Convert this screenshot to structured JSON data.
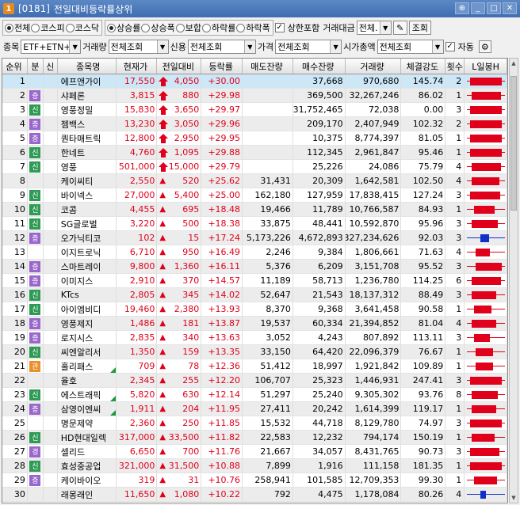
{
  "window": {
    "code": "[0181]",
    "title": "전일대비등락률상위",
    "icon": "1"
  },
  "market": {
    "options": [
      "전체",
      "코스피",
      "코스닥"
    ],
    "selected": 0
  },
  "direction": {
    "options": [
      "상승률",
      "상승폭",
      "보합",
      "하락률",
      "하락폭"
    ],
    "selected": 0
  },
  "include_limit": {
    "label": "상한포함",
    "checked": true
  },
  "amount": {
    "label": "거래대금",
    "value": "전체."
  },
  "query_label": "조회",
  "filters": {
    "kind_label": "종목",
    "kind_value": "ETF+ETN+스",
    "vol_label": "거래량",
    "vol_value": "전체조회",
    "credit_label": "신용",
    "credit_value": "전체조회",
    "price_label": "가격",
    "price_value": "전체조회",
    "cap_label": "시가총액",
    "cap_value": "전체조회",
    "auto_label": "자동",
    "auto_checked": true
  },
  "columns": [
    "순위",
    "분",
    "신",
    "종목명",
    "현재가",
    "전일대비",
    "등락률",
    "매도잔량",
    "매수잔량",
    "거래량",
    "체결강도",
    "횟수",
    "L일봉H"
  ],
  "colors": {
    "up": "#e0001b",
    "down": "#0030c8",
    "badge_green": "#2e9a55",
    "badge_purple": "#9966cc",
    "badge_orange": "#e8902a"
  },
  "rows": [
    {
      "rank": "1",
      "div": "",
      "divc": "",
      "credit": false,
      "name": "에프앤가이",
      "price": "17,550",
      "change": "4,050",
      "sign": "limit",
      "rate": "+30.00",
      "sell": "",
      "buy": "37,668",
      "vol": "970,680",
      "str": "145.74",
      "cnt": "2",
      "c": [
        0.05,
        0.95
      ],
      "cc": "r"
    },
    {
      "rank": "2",
      "div": "증",
      "divc": "purple",
      "credit": false,
      "name": "샤페론",
      "price": "3,815",
      "change": "880",
      "sign": "limit",
      "rate": "+29.98",
      "sell": "",
      "buy": "369,500",
      "vol": "32,267,246",
      "str": "86.02",
      "cnt": "1",
      "c": [
        0.1,
        0.95
      ],
      "cc": "r"
    },
    {
      "rank": "3",
      "div": "신",
      "divc": "green",
      "credit": false,
      "name": "영풍정밀",
      "price": "15,830",
      "change": "3,650",
      "sign": "limit",
      "rate": "+29.97",
      "sell": "",
      "buy": "31,752,465",
      "vol": "72,038",
      "str": "0.00",
      "cnt": "3",
      "c": [
        0.05,
        0.95
      ],
      "cc": "r"
    },
    {
      "rank": "4",
      "div": "증",
      "divc": "purple",
      "credit": false,
      "name": "젬백스",
      "price": "13,230",
      "change": "3,050",
      "sign": "limit",
      "rate": "+29.96",
      "sell": "",
      "buy": "209,170",
      "vol": "2,407,949",
      "str": "102.32",
      "cnt": "2",
      "c": [
        0.05,
        0.95
      ],
      "cc": "r"
    },
    {
      "rank": "5",
      "div": "증",
      "divc": "purple",
      "credit": false,
      "name": "퀀타매트릭",
      "price": "12,800",
      "change": "2,950",
      "sign": "limit",
      "rate": "+29.95",
      "sell": "",
      "buy": "10,375",
      "vol": "8,774,397",
      "str": "81.05",
      "cnt": "1",
      "c": [
        0.05,
        0.95
      ],
      "cc": "r"
    },
    {
      "rank": "6",
      "div": "신",
      "divc": "green",
      "credit": false,
      "name": "한네트",
      "price": "4,760",
      "change": "1,095",
      "sign": "limit",
      "rate": "+29.88",
      "sell": "",
      "buy": "112,345",
      "vol": "2,961,847",
      "str": "95.46",
      "cnt": "1",
      "c": [
        0.05,
        0.95
      ],
      "cc": "r"
    },
    {
      "rank": "7",
      "div": "신",
      "divc": "green",
      "credit": false,
      "name": "영풍",
      "price": "501,000",
      "change": "15,000",
      "sign": "limit",
      "rate": "+29.79",
      "sell": "",
      "buy": "25,226",
      "vol": "24,086",
      "str": "75.79",
      "cnt": "4",
      "c": [
        0.1,
        0.95
      ],
      "cc": "r"
    },
    {
      "rank": "8",
      "div": "",
      "divc": "",
      "credit": false,
      "name": "케이씨티",
      "price": "2,550",
      "change": "520",
      "sign": "up",
      "rate": "+25.62",
      "sell": "31,431",
      "buy": "20,309",
      "vol": "1,642,581",
      "str": "102.50",
      "cnt": "4",
      "c": [
        0.1,
        0.9
      ],
      "cc": "r"
    },
    {
      "rank": "9",
      "div": "신",
      "divc": "green",
      "credit": false,
      "name": "바이넥스",
      "price": "27,000",
      "change": "5,400",
      "sign": "up",
      "rate": "+25.00",
      "sell": "162,180",
      "buy": "127,959",
      "vol": "17,838,415",
      "str": "127.24",
      "cnt": "3",
      "c": [
        0.05,
        0.92
      ],
      "cc": "r"
    },
    {
      "rank": "10",
      "div": "신",
      "divc": "green",
      "credit": false,
      "name": "코콤",
      "price": "4,455",
      "change": "695",
      "sign": "up",
      "rate": "+18.48",
      "sell": "19,466",
      "buy": "11,789",
      "vol": "10,766,587",
      "str": "84.93",
      "cnt": "1",
      "c": [
        0.15,
        0.75
      ],
      "cc": "r"
    },
    {
      "rank": "11",
      "div": "신",
      "divc": "green",
      "credit": false,
      "name": "SG글로벌",
      "price": "3,220",
      "change": "500",
      "sign": "up",
      "rate": "+18.38",
      "sell": "33,875",
      "buy": "48,441",
      "vol": "10,592,870",
      "str": "95.96",
      "cnt": "3",
      "c": [
        0.1,
        0.85
      ],
      "cc": "r"
    },
    {
      "rank": "12",
      "div": "증",
      "divc": "purple",
      "credit": false,
      "name": "오가닉티코",
      "price": "102",
      "change": "15",
      "sign": "up",
      "rate": "+17.24",
      "sell": "5,173,226",
      "buy": "4,672,893",
      "vol": "327,234,626",
      "str": "92.03",
      "cnt": "3",
      "c": [
        0.35,
        0.6
      ],
      "cc": "b"
    },
    {
      "rank": "13",
      "div": "",
      "divc": "",
      "credit": false,
      "name": "이지트로닉",
      "price": "6,710",
      "change": "950",
      "sign": "up",
      "rate": "+16.49",
      "sell": "2,246",
      "buy": "9,384",
      "vol": "1,806,661",
      "str": "71.63",
      "cnt": "4",
      "c": [
        0.2,
        0.6
      ],
      "cc": "r"
    },
    {
      "rank": "14",
      "div": "증",
      "divc": "purple",
      "credit": false,
      "name": "스마트레이",
      "price": "9,800",
      "change": "1,360",
      "sign": "up",
      "rate": "+16.11",
      "sell": "5,376",
      "buy": "6,209",
      "vol": "3,151,708",
      "str": "95.52",
      "cnt": "3",
      "c": [
        0.2,
        0.95
      ],
      "cc": "r"
    },
    {
      "rank": "15",
      "div": "증",
      "divc": "purple",
      "credit": false,
      "name": "이미지스",
      "price": "2,910",
      "change": "370",
      "sign": "up",
      "rate": "+14.57",
      "sell": "11,189",
      "buy": "58,713",
      "vol": "1,236,780",
      "str": "114.25",
      "cnt": "6",
      "c": [
        0.1,
        0.95
      ],
      "cc": "r"
    },
    {
      "rank": "16",
      "div": "신",
      "divc": "green",
      "credit": false,
      "name": "KTcs",
      "price": "2,805",
      "change": "345",
      "sign": "up",
      "rate": "+14.02",
      "sell": "52,647",
      "buy": "21,543",
      "vol": "18,137,312",
      "str": "88.49",
      "cnt": "3",
      "c": [
        0.1,
        0.8
      ],
      "cc": "r"
    },
    {
      "rank": "17",
      "div": "신",
      "divc": "green",
      "credit": false,
      "name": "아이엠비디",
      "price": "19,460",
      "change": "2,380",
      "sign": "up",
      "rate": "+13.93",
      "sell": "8,370",
      "buy": "9,368",
      "vol": "3,641,458",
      "str": "90.58",
      "cnt": "1",
      "c": [
        0.15,
        0.65
      ],
      "cc": "r"
    },
    {
      "rank": "18",
      "div": "증",
      "divc": "purple",
      "credit": false,
      "name": "영풍제지",
      "price": "1,486",
      "change": "181",
      "sign": "up",
      "rate": "+13.87",
      "sell": "19,537",
      "buy": "60,334",
      "vol": "21,394,852",
      "str": "81.04",
      "cnt": "4",
      "c": [
        0.1,
        0.8
      ],
      "cc": "r"
    },
    {
      "rank": "19",
      "div": "증",
      "divc": "purple",
      "credit": false,
      "name": "로지시스",
      "price": "2,835",
      "change": "340",
      "sign": "up",
      "rate": "+13.63",
      "sell": "3,052",
      "buy": "4,243",
      "vol": "807,892",
      "str": "113.11",
      "cnt": "3",
      "c": [
        0.15,
        0.6
      ],
      "cc": "r"
    },
    {
      "rank": "20",
      "div": "신",
      "divc": "green",
      "credit": false,
      "name": "씨엔알리서",
      "price": "1,350",
      "change": "159",
      "sign": "up",
      "rate": "+13.35",
      "sell": "33,150",
      "buy": "64,420",
      "vol": "22,096,379",
      "str": "76.67",
      "cnt": "1",
      "c": [
        0.2,
        0.7
      ],
      "cc": "r"
    },
    {
      "rank": "21",
      "div": "관",
      "divc": "orange",
      "credit": true,
      "name": "홀리패스",
      "price": "709",
      "change": "78",
      "sign": "up",
      "rate": "+12.36",
      "sell": "51,412",
      "buy": "18,997",
      "vol": "1,921,842",
      "str": "109.89",
      "cnt": "1",
      "c": [
        0.2,
        0.7
      ],
      "cc": "r"
    },
    {
      "rank": "22",
      "div": "",
      "divc": "",
      "credit": false,
      "name": "율호",
      "price": "2,345",
      "change": "255",
      "sign": "up",
      "rate": "+12.20",
      "sell": "106,707",
      "buy": "25,323",
      "vol": "1,446,931",
      "str": "247.41",
      "cnt": "3",
      "c": [
        0.05,
        0.95
      ],
      "cc": "r"
    },
    {
      "rank": "23",
      "div": "신",
      "divc": "green",
      "credit": true,
      "name": "에스트래픽",
      "price": "5,820",
      "change": "630",
      "sign": "up",
      "rate": "+12.14",
      "sell": "51,297",
      "buy": "25,240",
      "vol": "9,305,302",
      "str": "93.76",
      "cnt": "8",
      "c": [
        0.1,
        0.85
      ],
      "cc": "r"
    },
    {
      "rank": "24",
      "div": "증",
      "divc": "purple",
      "credit": true,
      "name": "삼영이엔씨",
      "price": "1,911",
      "change": "204",
      "sign": "up",
      "rate": "+11.95",
      "sell": "27,411",
      "buy": "20,242",
      "vol": "1,614,399",
      "str": "119.17",
      "cnt": "1",
      "c": [
        0.1,
        0.8
      ],
      "cc": "r"
    },
    {
      "rank": "25",
      "div": "",
      "divc": "",
      "credit": false,
      "name": "명문제약",
      "price": "2,360",
      "change": "250",
      "sign": "up",
      "rate": "+11.85",
      "sell": "15,532",
      "buy": "44,718",
      "vol": "8,129,780",
      "str": "74.97",
      "cnt": "3",
      "c": [
        0.05,
        0.95
      ],
      "cc": "r"
    },
    {
      "rank": "26",
      "div": "신",
      "divc": "green",
      "credit": false,
      "name": "HD현대일렉",
      "price": "317,000",
      "change": "33,500",
      "sign": "up",
      "rate": "+11.82",
      "sell": "22,583",
      "buy": "12,232",
      "vol": "794,174",
      "str": "150.19",
      "cnt": "1",
      "c": [
        0.1,
        0.75
      ],
      "cc": "r"
    },
    {
      "rank": "27",
      "div": "경",
      "divc": "purple",
      "credit": false,
      "name": "셀리드",
      "price": "6,650",
      "change": "700",
      "sign": "up",
      "rate": "+11.76",
      "sell": "21,667",
      "buy": "34,057",
      "vol": "8,431,765",
      "str": "90.73",
      "cnt": "3",
      "c": [
        0.05,
        0.9
      ],
      "cc": "r"
    },
    {
      "rank": "28",
      "div": "신",
      "divc": "green",
      "credit": false,
      "name": "효성중공업",
      "price": "321,000",
      "change": "31,500",
      "sign": "up",
      "rate": "+10.88",
      "sell": "7,899",
      "buy": "1,916",
      "vol": "111,158",
      "str": "181.35",
      "cnt": "1",
      "c": [
        0.05,
        0.95
      ],
      "cc": "r"
    },
    {
      "rank": "29",
      "div": "증",
      "divc": "purple",
      "credit": false,
      "name": "케이바이오",
      "price": "319",
      "change": "31",
      "sign": "up",
      "rate": "+10.76",
      "sell": "258,941",
      "buy": "101,585",
      "vol": "12,709,353",
      "str": "99.30",
      "cnt": "1",
      "c": [
        0.15,
        0.8
      ],
      "cc": "r"
    },
    {
      "rank": "30",
      "div": "",
      "divc": "",
      "credit": false,
      "name": "래몽래인",
      "price": "11,650",
      "change": "1,080",
      "sign": "up",
      "rate": "+10.22",
      "sell": "792",
      "buy": "4,475",
      "vol": "1,178,084",
      "str": "80.26",
      "cnt": "4",
      "c": [
        0.35,
        0.5
      ],
      "cc": "b"
    }
  ]
}
